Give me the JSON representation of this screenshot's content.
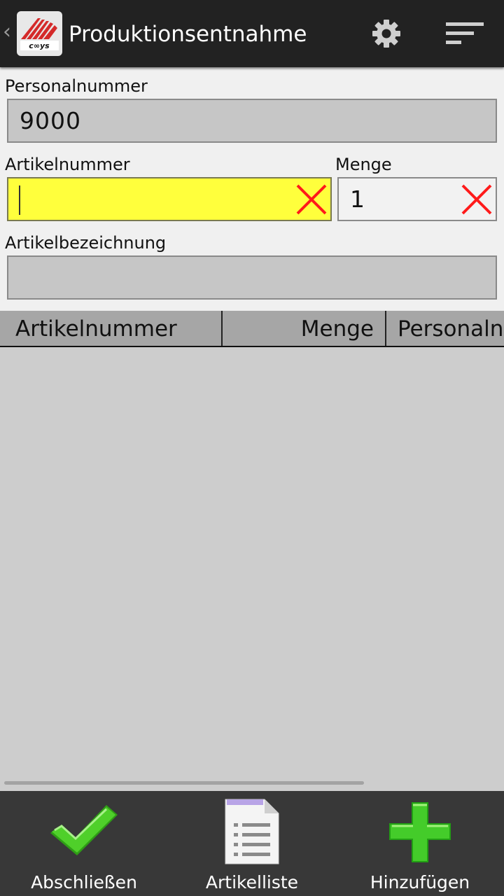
{
  "app": {
    "title": "Produktionsentnahme"
  },
  "form": {
    "personal": {
      "label": "Personalnummer",
      "value": "9000"
    },
    "artikel": {
      "label": "Artikelnummer",
      "value": ""
    },
    "menge": {
      "label": "Menge",
      "value": "1"
    },
    "bezeichnung": {
      "label": "Artikelbezeichnung",
      "value": ""
    }
  },
  "table": {
    "columns": [
      "Artikelnummer",
      "Menge",
      "Personalnummer"
    ],
    "rows": []
  },
  "bottom": {
    "finish_label": "Abschließen",
    "list_label": "Artikelliste",
    "add_label": "Hinzufügen"
  },
  "colors": {
    "actionbar": "#222222",
    "active_field": "#ffff3c",
    "clear_x": "#ff1a1a",
    "check_green": "#3cc31e",
    "plus_green": "#30c020",
    "bottombar": "#383838"
  },
  "icons": {
    "back": "chevron-left-icon",
    "logo": "app-logo-icon",
    "settings": "gear-icon",
    "menu": "overflow-menu-icon",
    "clear": "close-icon",
    "finish": "checkmark-icon",
    "list": "document-list-icon",
    "add": "plus-icon"
  }
}
